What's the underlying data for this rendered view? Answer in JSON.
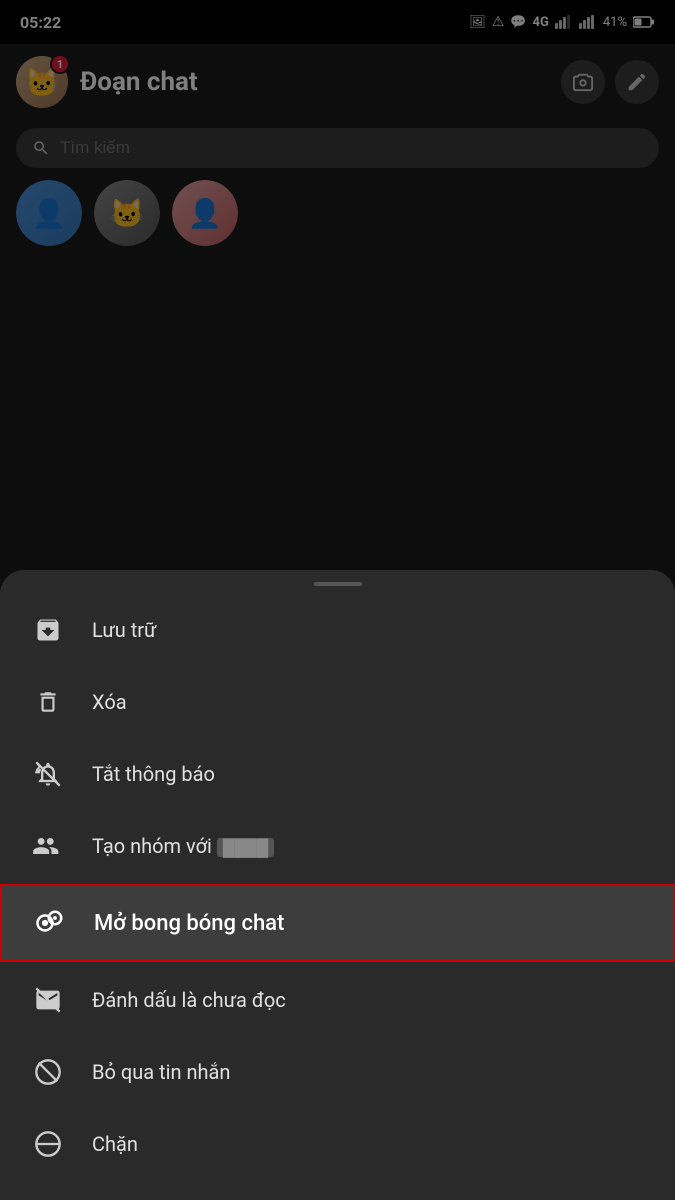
{
  "statusBar": {
    "time": "05:22",
    "network": "4G",
    "battery": "41%"
  },
  "header": {
    "title": "Đoạn chat",
    "notificationCount": "1"
  },
  "search": {
    "placeholder": "Tìm kiếm"
  },
  "menu": {
    "items": [
      {
        "id": "archive",
        "label": "Lưu trữ",
        "icon": "archive-icon",
        "highlighted": false
      },
      {
        "id": "delete",
        "label": "Xóa",
        "icon": "trash-icon",
        "highlighted": false
      },
      {
        "id": "mute",
        "label": "Tắt thông báo",
        "icon": "bell-off-icon",
        "highlighted": false
      },
      {
        "id": "create-group",
        "label": "Tạo nhóm với",
        "icon": "group-icon",
        "highlighted": false
      },
      {
        "id": "chat-bubble",
        "label": "Mở bong bóng chat",
        "icon": "bubble-icon",
        "highlighted": true
      },
      {
        "id": "mark-unread",
        "label": "Đánh dấu là chưa đọc",
        "icon": "unread-icon",
        "highlighted": false
      },
      {
        "id": "ignore",
        "label": "Bỏ qua tin nhắn",
        "icon": "ignore-icon",
        "highlighted": false
      },
      {
        "id": "block",
        "label": "Chặn",
        "icon": "block-icon",
        "highlighted": false
      }
    ]
  }
}
